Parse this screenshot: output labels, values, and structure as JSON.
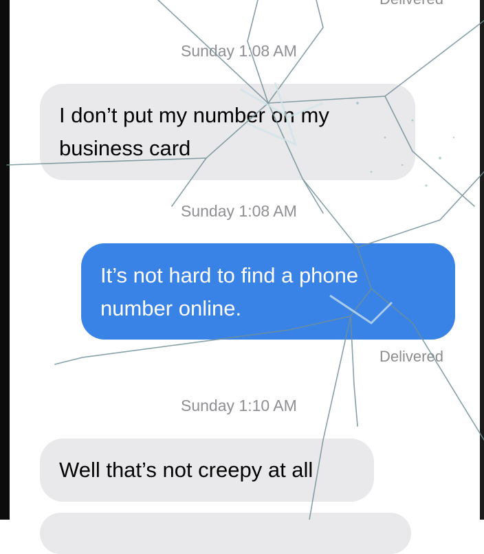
{
  "messages": [
    {
      "kind": "status",
      "text": "Delivered"
    },
    {
      "kind": "timestamp",
      "text": "Sunday 1:08 AM"
    },
    {
      "kind": "incoming",
      "text": "I don’t put my number on my business card"
    },
    {
      "kind": "timestamp",
      "text": "Sunday 1:08 AM"
    },
    {
      "kind": "outgoing",
      "text": "It’s not hard to find a phone number online."
    },
    {
      "kind": "status",
      "text": "Delivered"
    },
    {
      "kind": "timestamp",
      "text": "Sunday 1:10 AM"
    },
    {
      "kind": "incoming",
      "text": "Well that’s not creepy at all"
    }
  ],
  "colors": {
    "incoming_bubble": "#e9e9eb",
    "outgoing_bubble": "#3a83e6",
    "timestamp": "#8e8e93"
  },
  "overlay": "shattered-screen-cracks"
}
